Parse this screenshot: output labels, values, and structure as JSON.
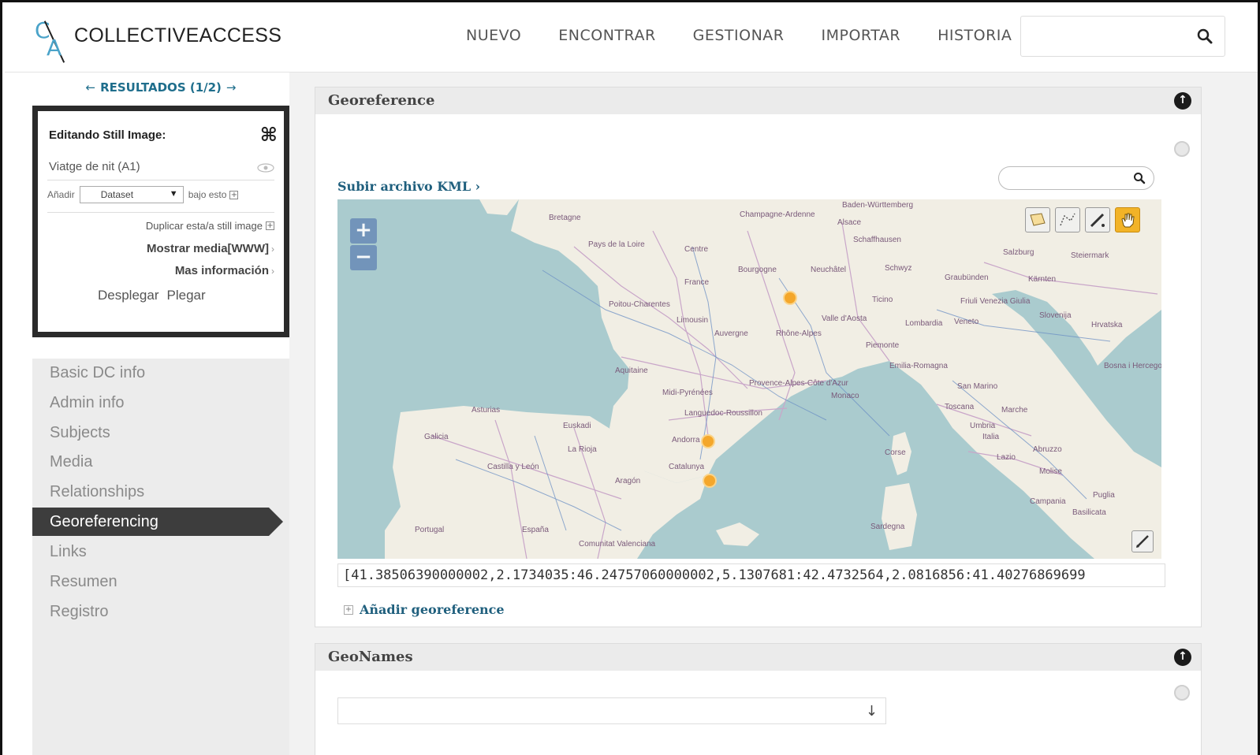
{
  "header": {
    "logo_text": "COLLECTIVEACCESS",
    "logo_mark": {
      "c": "C",
      "a": "A"
    },
    "nav": [
      "NUEVO",
      "ENCONTRAR",
      "GESTIONAR",
      "IMPORTAR",
      "HISTORIA"
    ],
    "search_placeholder": ""
  },
  "results": {
    "label": "RESULTADOS (1/2)",
    "prev": "←",
    "next": "→"
  },
  "editor": {
    "title": "Editando Still Image:",
    "record": "Viatge de nit (A1)",
    "add_label": "Añadir",
    "add_select": "Dataset",
    "add_suffix": "bajo esto",
    "duplicate": "Duplicar esta/a still image",
    "show_media": "Mostrar media[WWW]",
    "more_info": "Mas información",
    "expand": "Desplegar",
    "collapse": "Plegar"
  },
  "sidenav": {
    "items": [
      "Basic DC info",
      "Admin info",
      "Subjects",
      "Media",
      "Relationships",
      "Georeferencing",
      "Links",
      "Resumen",
      "Registro"
    ],
    "active": "Georeferencing"
  },
  "georeference": {
    "title": "Georeference",
    "upload_kml": "Subir archivo KML ›",
    "coordinates": "[41.38506390000002,2.1734035:46.24757060000002,5.1307681:42.4732564,2.0816856:41.40276869699",
    "add_link": "Añadir georeference",
    "map_search_placeholder": "",
    "map_labels": [
      "Bretagne",
      "Pays de la Loire",
      "Centre",
      "France",
      "Bourgogne",
      "Champagne-Ardenne",
      "Alsace",
      "Poitou-Charentes",
      "Limousin",
      "Auvergne",
      "Rhône-Alpes",
      "Aquitaine",
      "Midi-Pyrénées",
      "Provence-Alpes-Côte d'Azur",
      "Languedoc-Roussillon",
      "Monaco",
      "Asturias",
      "Galicia",
      "Euskadi",
      "La Rioja",
      "Castilla y León",
      "Aragón",
      "Andorra",
      "Catalunya",
      "Comunitat Valenciana",
      "Portugal",
      "España",
      "Lombardia",
      "Piemonte",
      "Valle d'Aosta",
      "Emilia-Romagna",
      "Toscana",
      "Umbria",
      "Marche",
      "Lazio",
      "Abruzzo",
      "Molise",
      "Campania",
      "Puglia",
      "Basilicata",
      "Corse",
      "Sardegna",
      "San Marino",
      "Italia",
      "Slovenija",
      "Hrvatska",
      "Bosna i Hercegovina",
      "Baden-Württemberg",
      "Schaffhausen",
      "Neuchâtel",
      "Schwyz",
      "Salzburg",
      "Steiermark",
      "Kärnten",
      "Ticino",
      "Friuli Venezia Giulia",
      "Veneto",
      "Graubünden"
    ]
  },
  "geonames": {
    "title": "GeoNames",
    "input_value": ""
  },
  "colors": {
    "accent": "#1f6e8c",
    "active_nav": "#3d3d3d",
    "marker": "#f4a72b",
    "sea": "#aacbce",
    "land": "#f1eee4"
  }
}
